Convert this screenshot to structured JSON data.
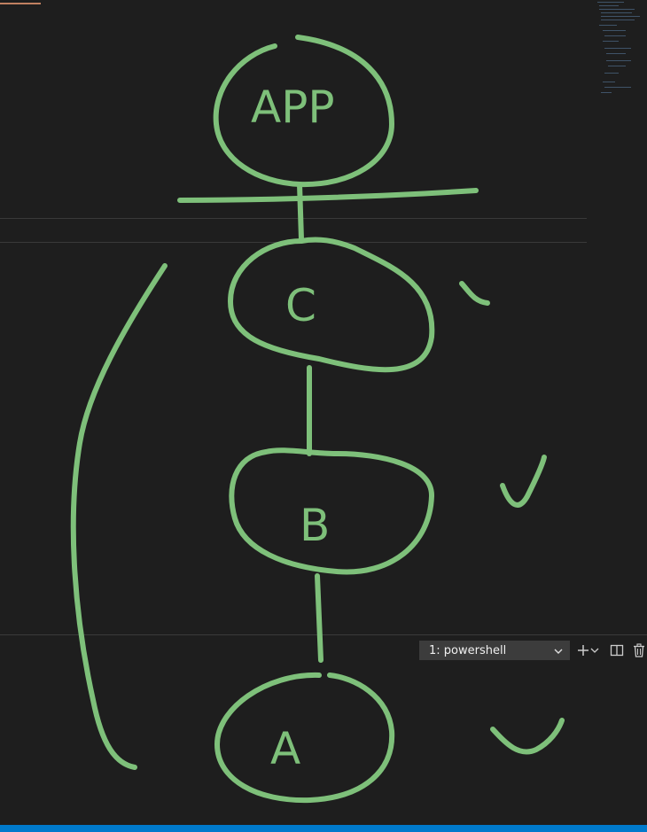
{
  "terminal": {
    "selected_shell": "1: powershell"
  },
  "drawing": {
    "stroke_color": "#7ec07a",
    "nodes": [
      {
        "label": "APP"
      },
      {
        "label": "C"
      },
      {
        "label": "B"
      },
      {
        "label": "A"
      }
    ]
  },
  "colors": {
    "editor_bg": "#1e1e1e",
    "status_bar": "#007acc",
    "dropdown_bg": "#3c3c3c"
  }
}
